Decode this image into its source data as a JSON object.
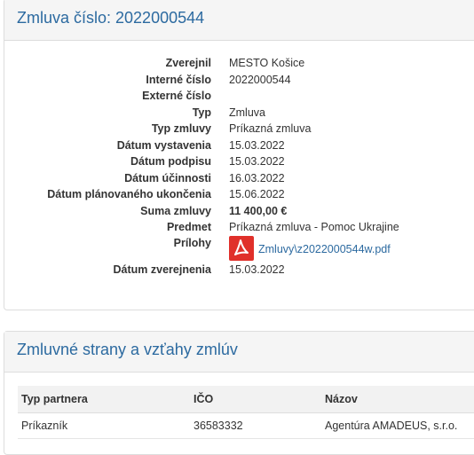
{
  "contract": {
    "title": "Zmluva číslo: 2022000544",
    "fields": [
      {
        "label": "Zverejnil",
        "value": "MESTO Košice"
      },
      {
        "label": "Interné číslo",
        "value": "2022000544"
      },
      {
        "label": "Externé číslo",
        "value": ""
      },
      {
        "label": "Typ",
        "value": "Zmluva"
      },
      {
        "label": "Typ zmluvy",
        "value": "Príkazná zmluva"
      },
      {
        "label": "Dátum vystavenia",
        "value": "15.03.2022"
      },
      {
        "label": "Dátum podpisu",
        "value": "15.03.2022"
      },
      {
        "label": "Dátum účinnosti",
        "value": "16.03.2022"
      },
      {
        "label": "Dátum plánovaného ukončenia",
        "value": "15.06.2022"
      },
      {
        "label": "Suma zmluvy",
        "value": "11 400,00 €"
      },
      {
        "label": "Predmet",
        "value": "Príkazná zmluva - Pomoc Ukrajine"
      }
    ],
    "attachments_label": "Prílohy",
    "attachment": {
      "name": "Zmluvy\\z2022000544w.pdf",
      "icon": "pdf-icon"
    },
    "published_label": "Dátum zverejnenia",
    "published_value": "15.03.2022"
  },
  "parties": {
    "title": "Zmluvné strany a vzťahy zmlúv",
    "columns": [
      "Typ partnera",
      "IČO",
      "Názov"
    ],
    "rows": [
      [
        "Príkazník",
        "36583332",
        "Agentúra AMADEUS, s.r.o."
      ]
    ]
  },
  "colors": {
    "accent": "#2c6aa0",
    "pdf": "#e0302a",
    "header_bg": "#f5f5f5"
  }
}
